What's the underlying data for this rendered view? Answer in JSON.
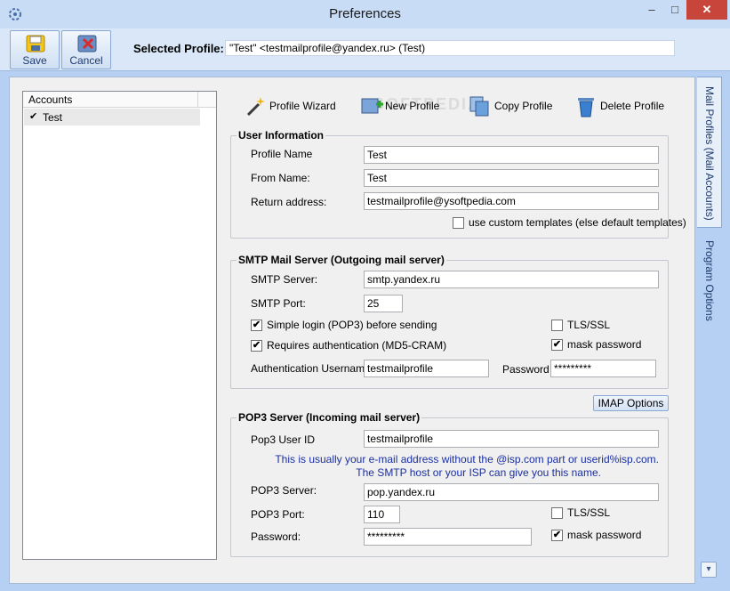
{
  "window": {
    "title": "Preferences",
    "minimize": "–",
    "maximize": "□",
    "close": "✕"
  },
  "toolbar": {
    "save_label": "Save",
    "cancel_label": "Cancel",
    "selected_profile_label": "Selected Profile:",
    "selected_profile_value": "\"Test\" <testmailprofile@yandex.ru> (Test)"
  },
  "accounts": {
    "header": "Accounts",
    "items": [
      {
        "name": "Test",
        "check": "✔"
      }
    ]
  },
  "actions": {
    "profile_wizard": "Profile Wizard",
    "new_profile": "New Profile",
    "copy_profile": "Copy Profile",
    "delete_profile": "Delete Profile"
  },
  "watermark": "SOFTPEDIA",
  "user_info": {
    "title": "User Information",
    "profile_name_label": "Profile Name",
    "profile_name_value": "Test",
    "from_name_label": "From Name:",
    "from_name_value": "Test",
    "return_address_label": "Return address:",
    "return_address_value": "testmailprofile@ysoftpedia.com",
    "custom_templates_label": "use custom templates (else default templates)",
    "custom_templates_checked": false
  },
  "smtp": {
    "title": "SMTP Mail Server (Outgoing mail server)",
    "server_label": "SMTP Server:",
    "server_value": "smtp.yandex.ru",
    "port_label": "SMTP Port:",
    "port_value": "25",
    "simple_login_label": "Simple login (POP3) before sending",
    "simple_login_checked": true,
    "requires_auth_label": "Requires authentication (MD5-CRAM)",
    "requires_auth_checked": true,
    "tls_label": "TLS/SSL",
    "tls_checked": false,
    "mask_label": "mask password",
    "mask_checked": true,
    "auth_user_label": "Authentication Username",
    "auth_user_value": "testmailprofile",
    "password_label": "Password",
    "password_value": "*********"
  },
  "imap_button": "IMAP Options",
  "pop3": {
    "title": "POP3 Server (Incoming mail server)",
    "user_id_label": "Pop3 User ID",
    "user_id_value": "testmailprofile",
    "hint_line1": "This is usually your e-mail address without the @isp.com part or userid%isp.com.",
    "hint_line2": "The SMTP host or your ISP can give you this name.",
    "server_label": "POP3 Server:",
    "server_value": "pop.yandex.ru",
    "port_label": "POP3 Port:",
    "port_value": "110",
    "password_label": "Password:",
    "password_value": "*********",
    "tls_label": "TLS/SSL",
    "tls_checked": false,
    "mask_label": "mask password",
    "mask_checked": true
  },
  "tabs": {
    "mail_profiles": "Mail Profiles (Mail Accounts)",
    "program_options": "Program Options"
  },
  "check_glyph": "✔",
  "scroll_glyph": "▾"
}
